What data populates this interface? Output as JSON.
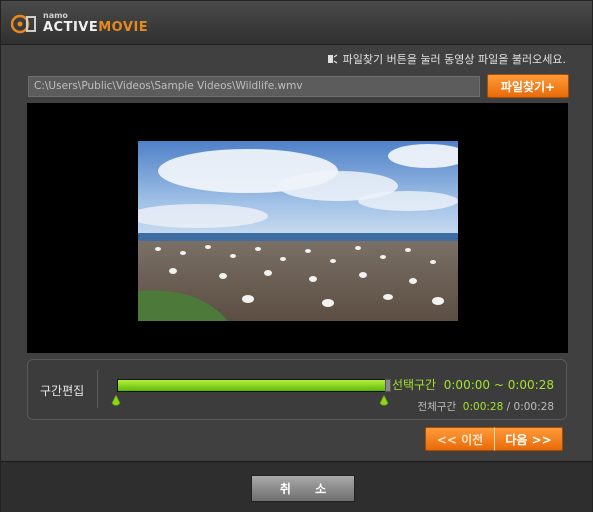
{
  "brand": {
    "small": "namo",
    "main_part1": "ACTIVE",
    "main_part2": "MOVIE"
  },
  "hint": {
    "text": "파일찾기 버튼을 눌러 동영상 파일을 불러오세요."
  },
  "file": {
    "path": "C:\\Users\\Public\\Videos\\Sample Videos\\Wildlife.wmv",
    "browse_label": "파일찾기+"
  },
  "edit": {
    "label": "구간편집",
    "selection_label": "선택구간",
    "selection_start": "0:00:00",
    "selection_sep": "~",
    "selection_end": "0:00:28",
    "total_label": "전체구간",
    "total_value": "0:00:28",
    "total_sep": "/",
    "total_duration": "0:00:28",
    "fill_fraction": 1.0
  },
  "nav": {
    "prev_label": "<< 이전",
    "next_label": "다음 >>"
  },
  "footer": {
    "cancel_label": "취 소"
  },
  "colors": {
    "accent_orange": "#f07a12",
    "progress_green": "#8ed21a",
    "time_green": "#a6e22e"
  }
}
